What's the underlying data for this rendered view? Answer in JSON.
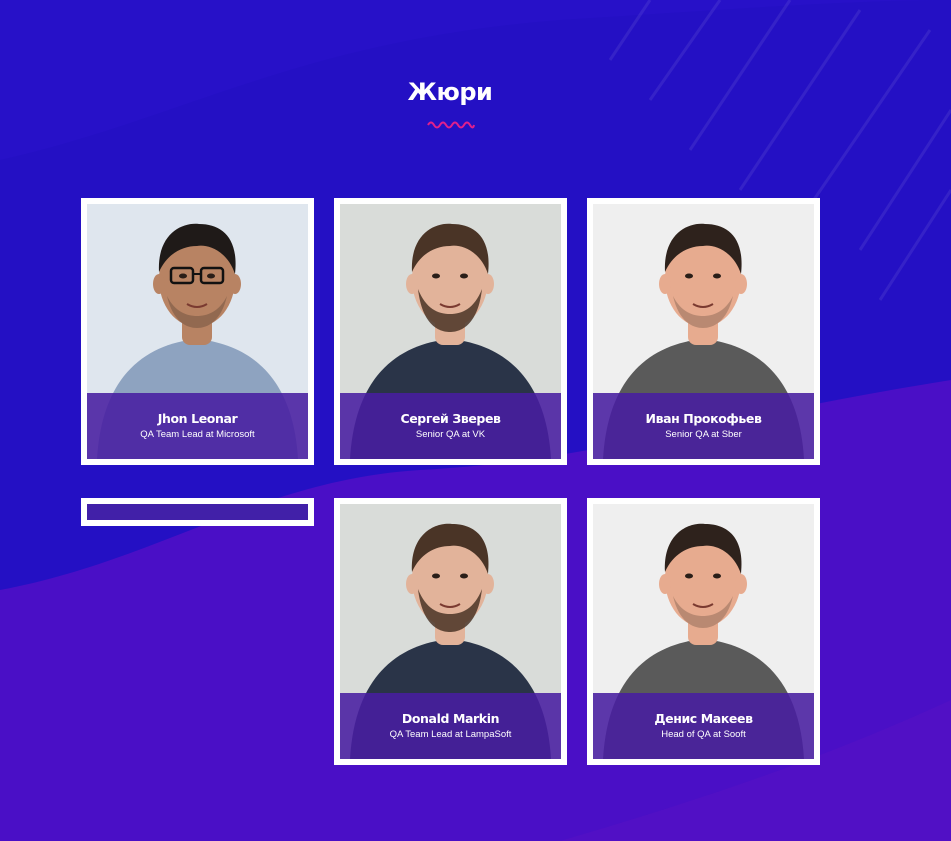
{
  "section": {
    "title": "Жюри"
  },
  "colors": {
    "background": "#2410c4",
    "background_lower": "#4a0fc6",
    "accent_wave": "#e0208c",
    "caption_overlay": "#481ea0",
    "card_border": "#ffffff"
  },
  "jury": [
    {
      "name": "Jhon Leonar",
      "role": "QA Team Lead at Microsoft",
      "photo_bg": "#dfe6ee",
      "shirt": "#8ea3c0",
      "skin": "#b88363",
      "hair": "#1f1a18",
      "glasses": true,
      "beard": "stubble"
    },
    {
      "name": "Сергей Зверев",
      "role": "Senior QA at VK",
      "photo_bg": "#d9dcd9",
      "shirt": "#2a3448",
      "skin": "#e2b39a",
      "hair": "#4a3426",
      "glasses": false,
      "beard": "full"
    },
    {
      "name": "Иван Прокофьев",
      "role": "Senior QA at Sber",
      "photo_bg": "#efefef",
      "shirt": "#5a5a5a",
      "skin": "#e7ab8f",
      "hair": "#2e221c",
      "glasses": false,
      "beard": "stubble"
    },
    {
      "name": "Donald Markin",
      "role": "QA Team Lead at LampaSoft",
      "photo_bg": "#d9dcd9",
      "shirt": "#2a3448",
      "skin": "#e2b39a",
      "hair": "#4a3426",
      "glasses": false,
      "beard": "full"
    },
    {
      "name": "Денис Макеев",
      "role": "Head of QA at Sooft",
      "photo_bg": "#efefef",
      "shirt": "#5a5a5a",
      "skin": "#e7ab8f",
      "hair": "#2e221c",
      "glasses": false,
      "beard": "stubble"
    }
  ]
}
